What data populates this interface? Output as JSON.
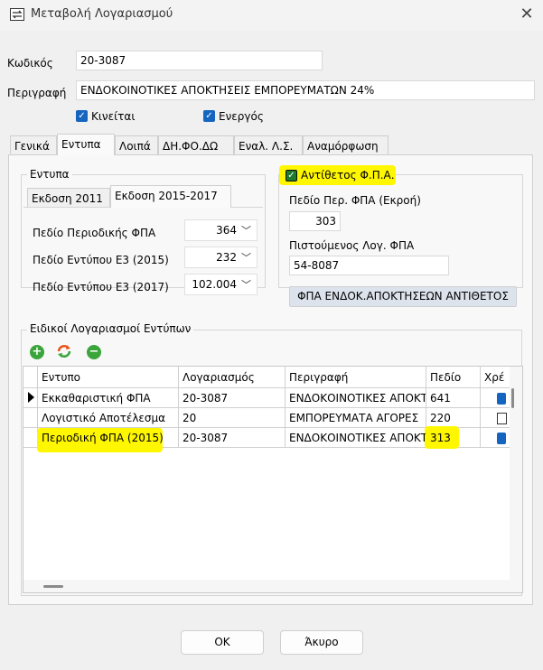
{
  "window": {
    "title": "Μεταβολή Λογαριασμού",
    "close_glyph": "✕"
  },
  "form": {
    "code_label": "Κωδικός",
    "code_value": "20-3087",
    "desc_label": "Περιγραφή",
    "desc_value": "ΕΝΔΟΚΟΙΝΟΤΙΚΕΣ ΑΠΟΚΤΗΣΕΙΣ ΕΜΠΟΡΕΥΜΑΤΩΝ 24%",
    "moving_label": "Κινείται",
    "moving_checked": true,
    "active_label": "Ενεργός",
    "active_checked": true
  },
  "tabs": [
    "Γενικά",
    "Εντυπα",
    "Λοιπά",
    "ΔΗ.ΦΟ.ΔΩ",
    "Εναλ. Λ.Σ.",
    "Αναμόρφωση"
  ],
  "active_tab": "Εντυπα",
  "forms_group": {
    "title": "Εντυπα",
    "subtabs": [
      "Εκδοση 2011",
      "Εκδοση 2015-2017"
    ],
    "active_subtab": "Εκδοση 2015-2017",
    "fields": [
      {
        "label": "Πεδίο Περιοδικής ΦΠΑ",
        "value": "364"
      },
      {
        "label": "Πεδίο Εντύπου Ε3 (2015)",
        "value": "232"
      },
      {
        "label": "Πεδίο Εντύπου Ε3 (2017)",
        "value": "102.004"
      }
    ]
  },
  "reverse_vat": {
    "checkbox_label": "Αντίθετος Φ.Π.Α.",
    "checked": true,
    "field_label": "Πεδίο Περ. ΦΠΑ (Εκροή)",
    "field_value": "303",
    "account_label": "Πιστούμενος Λογ. ΦΠΑ",
    "account_value": "54-8087",
    "account_desc_button": "ΦΠΑ ΕΝΔΟΚ.ΑΠΟΚΤΗΣΕΩΝ ΑΝΤΙΘΕΤΟΣ"
  },
  "special_accounts": {
    "title": "Ειδικοί Λογαριασμοί Εντύπων",
    "toolbar_icons": [
      "add-icon",
      "refresh-icon",
      "remove-icon"
    ],
    "columns": [
      "Εντυπο",
      "Λογαριασμός",
      "Περιγραφή",
      "Πεδίο",
      "Χρέ"
    ],
    "rows": [
      {
        "form": "Εκκαθαριστική ΦΠΑ",
        "account": "20-3087",
        "description": "ΕΝΔΟΚΟΙΝΟΤΙΚΕΣ ΑΠΟΚΤ",
        "field": "641",
        "debit": true,
        "current": true,
        "highlight": false
      },
      {
        "form": "Λογιστικό Αποτέλεσμα",
        "account": "20",
        "description": "ΕΜΠΟΡΕΥΜΑΤΑ ΑΓΟΡΕΣ",
        "field": "220",
        "debit": false,
        "current": false,
        "highlight": false
      },
      {
        "form": "Περιοδική ΦΠΑ (2015)",
        "account": "20-3087",
        "description": "ΕΝΔΟΚΟΙΝΟΤΙΚΕΣ ΑΠΟΚΤ",
        "field": "313",
        "debit": true,
        "current": false,
        "highlight": true
      }
    ]
  },
  "buttons": {
    "ok": "OK",
    "cancel": "Άκυρο"
  },
  "colors": {
    "highlight": "#fff700",
    "check_blue": "#1565c0",
    "check_green": "#1e7a2e"
  }
}
